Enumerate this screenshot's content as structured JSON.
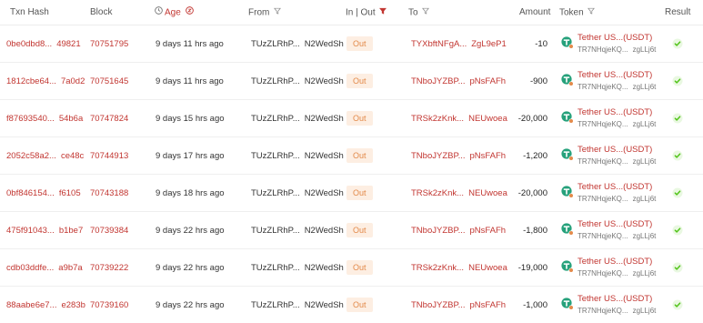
{
  "columns": {
    "txn_hash": "Txn Hash",
    "block": "Block",
    "age": "Age",
    "from": "From",
    "in_out": "In | Out",
    "to": "To",
    "amount": "Amount",
    "token": "Token",
    "result": "Result"
  },
  "icons": {
    "age_clock": "clock-icon",
    "filter": "filter-icon",
    "filter_active": "filter-active-icon",
    "token_logo": "tether-icon",
    "result_ok": "check-circle-icon",
    "age_info": "info-icon"
  },
  "colors": {
    "link": "#c23631",
    "pill_bg": "#fdeee2",
    "pill_text": "#e38a4a",
    "tether": "#26a17b",
    "success": "#52c41a"
  },
  "rows": [
    {
      "hash_start": "0be0dbd8...",
      "hash_end": "49821",
      "block": "70751795",
      "age": "9 days 11 hrs ago",
      "from_start": "TUzZLRhP...",
      "from_end": "N2WedSh",
      "direction": "Out",
      "to_start": "TYXbftNFgA...",
      "to_end": "ZgL9eP1",
      "amount": "-10",
      "token_name": "Tether US...(USDT)",
      "token_addr_start": "TR7NHqjeKQ...",
      "token_addr_end": "zgLLj6t"
    },
    {
      "hash_start": "1812cbe64...",
      "hash_end": "7a0d2",
      "block": "70751645",
      "age": "9 days 11 hrs ago",
      "from_start": "TUzZLRhP...",
      "from_end": "N2WedSh",
      "direction": "Out",
      "to_start": "TNboJYZBP...",
      "to_end": "pNsFAFh",
      "amount": "-900",
      "token_name": "Tether US...(USDT)",
      "token_addr_start": "TR7NHqjeKQ...",
      "token_addr_end": "zgLLj6t"
    },
    {
      "hash_start": "f87693540...",
      "hash_end": "54b6a",
      "block": "70747824",
      "age": "9 days 15 hrs ago",
      "from_start": "TUzZLRhP...",
      "from_end": "N2WedSh",
      "direction": "Out",
      "to_start": "TRSk2zKnk...",
      "to_end": "NEUwoea",
      "amount": "-20,000",
      "token_name": "Tether US...(USDT)",
      "token_addr_start": "TR7NHqjeKQ...",
      "token_addr_end": "zgLLj6t"
    },
    {
      "hash_start": "2052c58a2...",
      "hash_end": "ce48c",
      "block": "70744913",
      "age": "9 days 17 hrs ago",
      "from_start": "TUzZLRhP...",
      "from_end": "N2WedSh",
      "direction": "Out",
      "to_start": "TNboJYZBP...",
      "to_end": "pNsFAFh",
      "amount": "-1,200",
      "token_name": "Tether US...(USDT)",
      "token_addr_start": "TR7NHqjeKQ...",
      "token_addr_end": "zgLLj6t"
    },
    {
      "hash_start": "0bf846154...",
      "hash_end": "f6105",
      "block": "70743188",
      "age": "9 days 18 hrs ago",
      "from_start": "TUzZLRhP...",
      "from_end": "N2WedSh",
      "direction": "Out",
      "to_start": "TRSk2zKnk...",
      "to_end": "NEUwoea",
      "amount": "-20,000",
      "token_name": "Tether US...(USDT)",
      "token_addr_start": "TR7NHqjeKQ...",
      "token_addr_end": "zgLLj6t"
    },
    {
      "hash_start": "475f91043...",
      "hash_end": "b1be7",
      "block": "70739384",
      "age": "9 days 22 hrs ago",
      "from_start": "TUzZLRhP...",
      "from_end": "N2WedSh",
      "direction": "Out",
      "to_start": "TNboJYZBP...",
      "to_end": "pNsFAFh",
      "amount": "-1,800",
      "token_name": "Tether US...(USDT)",
      "token_addr_start": "TR7NHqjeKQ...",
      "token_addr_end": "zgLLj6t"
    },
    {
      "hash_start": "cdb03ddfe...",
      "hash_end": "a9b7a",
      "block": "70739222",
      "age": "9 days 22 hrs ago",
      "from_start": "TUzZLRhP...",
      "from_end": "N2WedSh",
      "direction": "Out",
      "to_start": "TRSk2zKnk...",
      "to_end": "NEUwoea",
      "amount": "-19,000",
      "token_name": "Tether US...(USDT)",
      "token_addr_start": "TR7NHqjeKQ...",
      "token_addr_end": "zgLLj6t"
    },
    {
      "hash_start": "88aabe6e7...",
      "hash_end": "e283b",
      "block": "70739160",
      "age": "9 days 22 hrs ago",
      "from_start": "TUzZLRhP...",
      "from_end": "N2WedSh",
      "direction": "Out",
      "to_start": "TNboJYZBP...",
      "to_end": "pNsFAFh",
      "amount": "-1,000",
      "token_name": "Tether US...(USDT)",
      "token_addr_start": "TR7NHqjeKQ...",
      "token_addr_end": "zgLLj6t"
    }
  ]
}
